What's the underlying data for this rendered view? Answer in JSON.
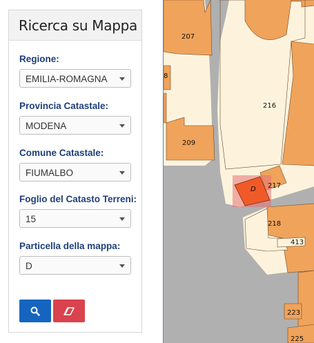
{
  "panel": {
    "title": "Ricerca su Mappa",
    "fields": [
      {
        "label": "Regione:",
        "value": "EMILIA-ROMAGNA"
      },
      {
        "label": "Provincia Catastale:",
        "value": "MODENA"
      },
      {
        "label": "Comune Catastale:",
        "value": "FIUMALBO"
      },
      {
        "label": "Foglio del Catasto Terreni:",
        "value": "15"
      },
      {
        "label": "Particella della mappa:",
        "value": "D"
      }
    ],
    "buttons": {
      "search_icon": "search-icon",
      "clear_icon": "eraser-icon"
    }
  },
  "map": {
    "parcels": [
      "207",
      "8",
      "216",
      "209",
      "217",
      "218",
      "413",
      "223",
      "225"
    ],
    "selected_parcel": "D",
    "colors": {
      "building": "#f0a35a",
      "land": "#fdf3dd",
      "road": "#b0b0b0",
      "selected": "#f05a28",
      "highlight": "#e57373"
    }
  }
}
